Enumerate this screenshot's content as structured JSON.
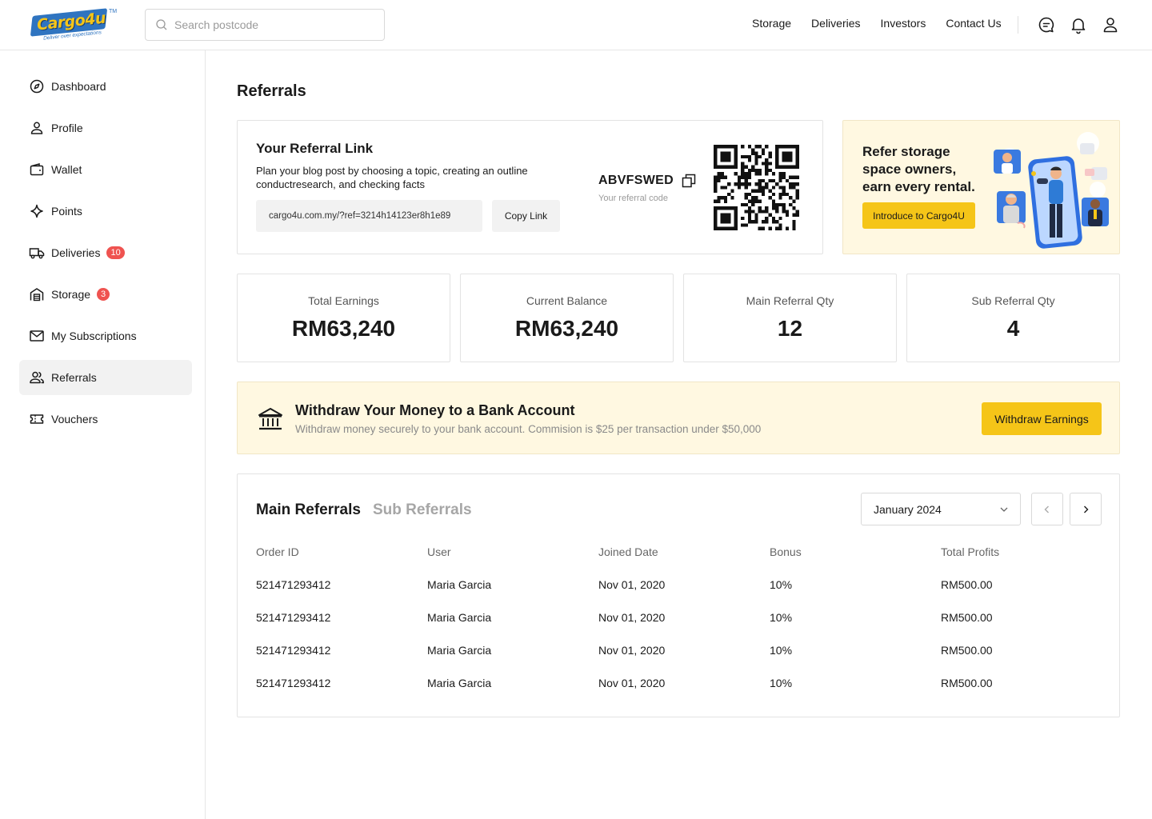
{
  "brand": {
    "logo_text": "Cargo4u",
    "tagline": "Deliver over expectations",
    "tm": "TM"
  },
  "search": {
    "placeholder": "Search postcode"
  },
  "topnav": [
    "Storage",
    "Deliveries",
    "Investors",
    "Contact Us"
  ],
  "sidebar": {
    "items": [
      {
        "label": "Dashboard",
        "icon": "compass-icon"
      },
      {
        "label": "Profile",
        "icon": "user-icon"
      },
      {
        "label": "Wallet",
        "icon": "wallet-icon"
      },
      {
        "label": "Points",
        "icon": "sparkle-icon"
      },
      {
        "label": "Deliveries",
        "icon": "truck-icon",
        "badge": "10"
      },
      {
        "label": "Storage",
        "icon": "warehouse-icon",
        "badge": "3"
      },
      {
        "label": "My Subscriptions",
        "icon": "mail-icon"
      },
      {
        "label": "Referrals",
        "icon": "users-icon",
        "active": true
      },
      {
        "label": "Vouchers",
        "icon": "ticket-icon"
      }
    ]
  },
  "page": {
    "title": "Referrals"
  },
  "referral": {
    "title": "Your Referral Link",
    "description": "Plan your blog post by choosing a topic, creating an outline conductresearch, and checking facts",
    "link": "cargo4u.com.my/?ref=3214h14123er8h1e89",
    "copy_label": "Copy Link",
    "code": "ABVFSWED",
    "code_label": "Your referral code"
  },
  "promo": {
    "text": "Refer storage space owners, earn every rental.",
    "button": "Introduce to Cargo4U"
  },
  "stats": [
    {
      "label": "Total Earnings",
      "value": "RM63,240"
    },
    {
      "label": "Current Balance",
      "value": "RM63,240"
    },
    {
      "label": "Main Referral Qty",
      "value": "12"
    },
    {
      "label": "Sub Referral Qty",
      "value": "4"
    }
  ],
  "withdraw": {
    "title": "Withdraw Your Money to a Bank Account",
    "description": "Withdraw money securely to your bank account. Commision is $25 per transaction under $50,000",
    "button": "Withdraw Earnings"
  },
  "table": {
    "tabs": [
      "Main Referrals",
      "Sub Referrals"
    ],
    "month": "January 2024",
    "columns": [
      "Order ID",
      "User",
      "Joined Date",
      "Bonus",
      "Total Profits"
    ],
    "rows": [
      [
        "521471293412",
        "Maria Garcia",
        "Nov 01, 2020",
        "10%",
        "RM500.00"
      ],
      [
        "521471293412",
        "Maria Garcia",
        "Nov 01, 2020",
        "10%",
        "RM500.00"
      ],
      [
        "521471293412",
        "Maria Garcia",
        "Nov 01, 2020",
        "10%",
        "RM500.00"
      ],
      [
        "521471293412",
        "Maria Garcia",
        "Nov 01, 2020",
        "10%",
        "RM500.00"
      ]
    ]
  },
  "colors": {
    "accent": "#f5c518",
    "badge": "#ef5350",
    "brand_blue": "#2f74c0",
    "promo_bg": "#fff8e1"
  }
}
